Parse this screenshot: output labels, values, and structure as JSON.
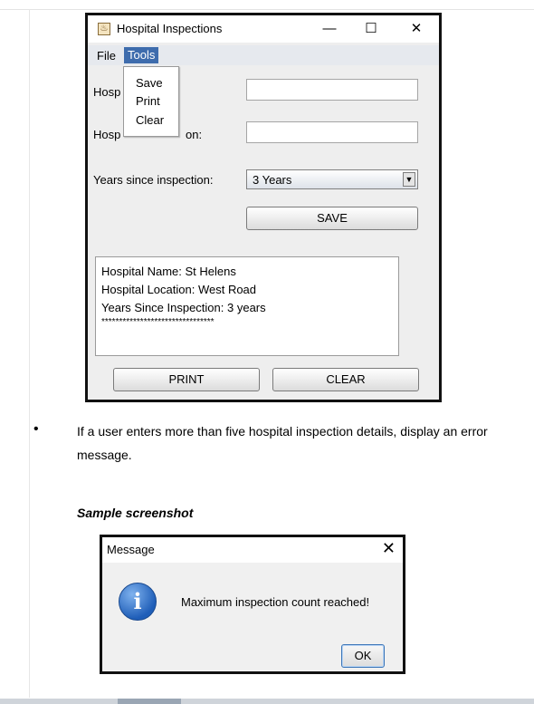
{
  "window": {
    "title": "Hospital Inspections",
    "icon": "java-cup-icon",
    "minimize": "—",
    "maximize": "☐",
    "close": "✕"
  },
  "menubar": {
    "file": "File",
    "tools": "Tools"
  },
  "tools_menu": {
    "items": [
      "Save",
      "Print",
      "Clear"
    ]
  },
  "form": {
    "name_label_visible": "Hosp",
    "location_label_left": "Hosp",
    "location_label_right": "on:",
    "name_value": "",
    "location_value": "",
    "years_label": "Years since inspection:",
    "years_selected": "3 Years",
    "save_button": "SAVE"
  },
  "output": {
    "lines": [
      "Hospital Name: St Helens",
      "Hospital Location: West Road",
      "Years Since Inspection: 3 years"
    ],
    "separator": "********************************"
  },
  "buttons": {
    "print": "PRINT",
    "clear": "CLEAR"
  },
  "doc": {
    "bullet": "•",
    "paragraph": "If a user enters more than five hospital inspection details, display an error message.",
    "caption": "Sample screenshot"
  },
  "dialog": {
    "title": "Message",
    "close": "✕",
    "icon": "info-icon",
    "icon_glyph": "i",
    "message": "Maximum inspection count reached!",
    "ok": "OK"
  }
}
